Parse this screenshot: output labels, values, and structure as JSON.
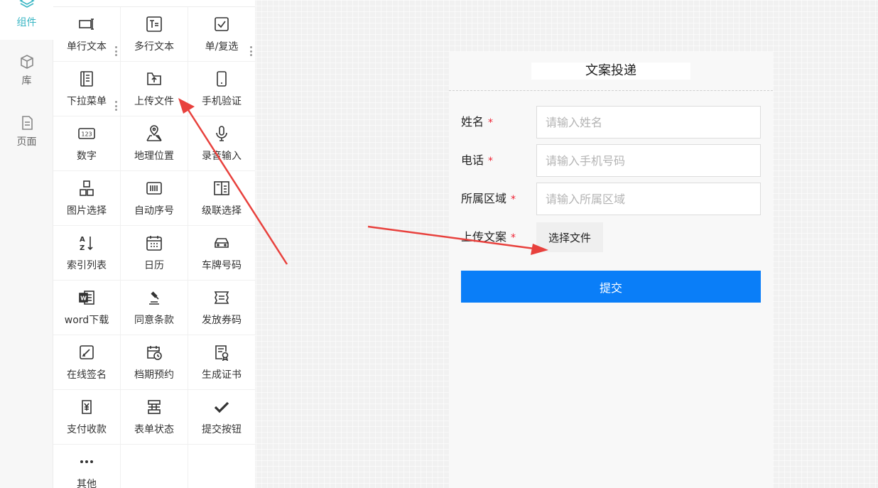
{
  "rail": {
    "items": [
      {
        "label": "组件",
        "icon": "layers-icon",
        "active": true
      },
      {
        "label": "库",
        "icon": "box-icon",
        "active": false
      },
      {
        "label": "页面",
        "icon": "document-icon",
        "active": false
      }
    ]
  },
  "palette": {
    "items": [
      {
        "label": "单行文本",
        "icon": "single-line-text-icon"
      },
      {
        "label": "多行文本",
        "icon": "multi-line-text-icon"
      },
      {
        "label": "单/复选",
        "icon": "checkbox-icon"
      },
      {
        "label": "下拉菜单",
        "icon": "dropdown-list-icon"
      },
      {
        "label": "上传文件",
        "icon": "upload-folder-icon"
      },
      {
        "label": "手机验证",
        "icon": "mobile-phone-icon"
      },
      {
        "label": "数字",
        "icon": "number-123-icon"
      },
      {
        "label": "地理位置",
        "icon": "map-location-icon"
      },
      {
        "label": "录音输入",
        "icon": "microphone-icon"
      },
      {
        "label": "图片选择",
        "icon": "image-grid-icon"
      },
      {
        "label": "自动序号",
        "icon": "barcode-icon"
      },
      {
        "label": "级联选择",
        "icon": "cascade-panel-icon"
      },
      {
        "label": "索引列表",
        "icon": "sort-az-icon"
      },
      {
        "label": "日历",
        "icon": "calendar-icon"
      },
      {
        "label": "车牌号码",
        "icon": "car-icon"
      },
      {
        "label": "word下载",
        "icon": "word-file-icon"
      },
      {
        "label": "同意条款",
        "icon": "gavel-icon"
      },
      {
        "label": "发放券码",
        "icon": "ticket-icon"
      },
      {
        "label": "在线签名",
        "icon": "signature-pen-icon"
      },
      {
        "label": "档期预约",
        "icon": "calendar-clock-icon"
      },
      {
        "label": "生成证书",
        "icon": "certificate-icon"
      },
      {
        "label": "支付收款",
        "icon": "payment-yuan-icon"
      },
      {
        "label": "表单状态",
        "icon": "form-status-icon"
      },
      {
        "label": "提交按钮",
        "icon": "checkmark-icon"
      },
      {
        "label": "其他",
        "icon": "more-dots-icon"
      }
    ]
  },
  "phone": {
    "title": "文案投递",
    "fields": [
      {
        "label": "姓名",
        "required_mark": "*",
        "placeholder": "请输入姓名"
      },
      {
        "label": "电话",
        "required_mark": "*",
        "placeholder": "请输入手机号码"
      },
      {
        "label": "所属区域",
        "required_mark": "*",
        "placeholder": "请输入所属区域"
      }
    ],
    "upload": {
      "label": "上传文案",
      "required_mark": "*",
      "button": "选择文件"
    },
    "submit_label": "提交"
  },
  "colors": {
    "accent": "#3ab6c4",
    "submit": "#0a7ef8",
    "required": "#e23",
    "arrow": "#e8413d"
  }
}
